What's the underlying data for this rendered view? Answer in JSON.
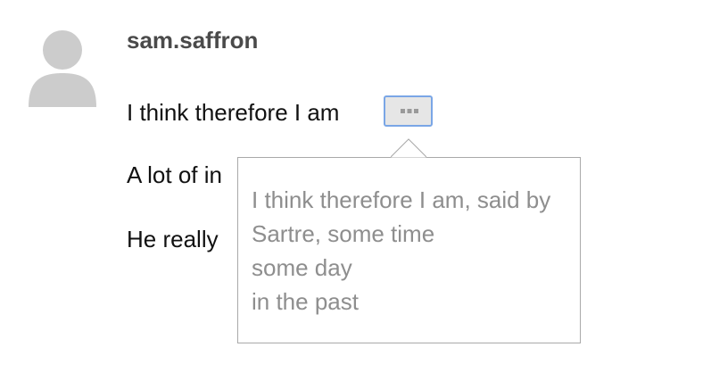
{
  "post": {
    "username": "sam.saffron",
    "lines": [
      "I think therefore I am",
      "A lot of in",
      "He really"
    ],
    "expand_button": {
      "icon": "ellipsis-icon"
    }
  },
  "popup": {
    "lines": [
      "I think therefore I am, said by",
      "Sartre, some time",
      "some day",
      "in the past"
    ]
  },
  "colors": {
    "avatar": "#cccccc",
    "username": "#4a4a4a",
    "button_border": "#7aa6e6",
    "popup_text": "#8e8e8e",
    "popup_border": "#a9a9a9"
  }
}
